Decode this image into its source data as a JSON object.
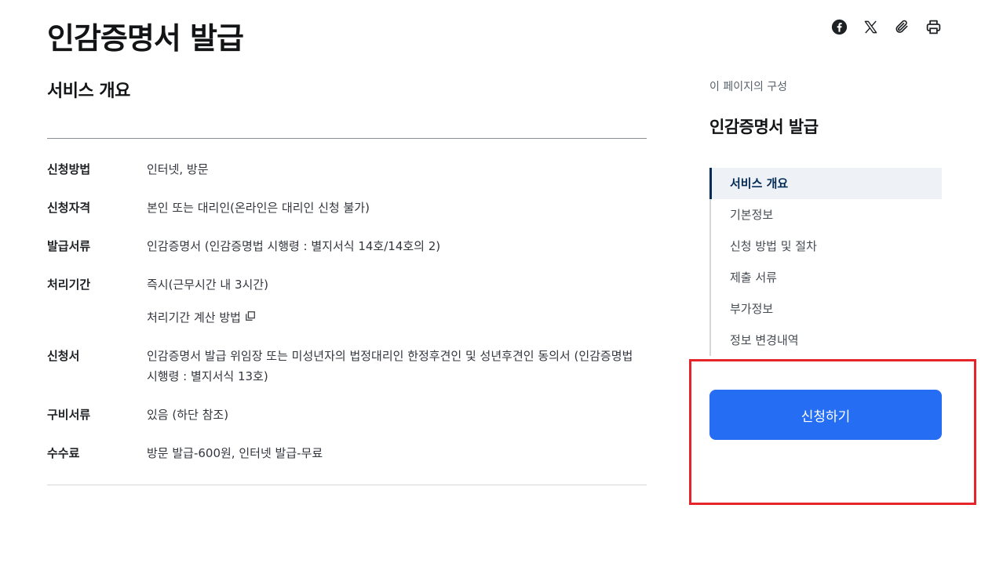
{
  "page": {
    "title": "인감증명서 발급"
  },
  "share": {
    "icons": [
      "facebook-icon",
      "x-icon",
      "paperclip-icon",
      "printer-icon"
    ]
  },
  "overview": {
    "title": "서비스 개요",
    "rows": [
      {
        "label": "신청방법",
        "value": "인터넷, 방문"
      },
      {
        "label": "신청자격",
        "value": "본인 또는 대리인(온라인은 대리인 신청 불가)"
      },
      {
        "label": "발급서류",
        "value": "인감증명서 (인감증명법 시행령 : 별지서식 14호/14호의 2)"
      },
      {
        "label": "처리기간",
        "value": "즉시(근무시간 내 3시간)",
        "link": "처리기간 계산 방법"
      },
      {
        "label": "신청서",
        "value": "인감증명서 발급 위임장 또는 미성년자의 법정대리인 한정후견인 및 성년후견인 동의서 (인감증명법 시행령 : 별지서식 13호)"
      },
      {
        "label": "구비서류",
        "value": "있음 (하단 참조)"
      },
      {
        "label": "수수료",
        "value": "방문 발급-600원, 인터넷 발급-무료"
      }
    ]
  },
  "toc": {
    "caption": "이 페이지의 구성",
    "title": "인감증명서 발급",
    "items": [
      {
        "label": "서비스 개요",
        "active": true
      },
      {
        "label": "기본정보",
        "active": false
      },
      {
        "label": "신청 방법 및 절차",
        "active": false
      },
      {
        "label": "제출 서류",
        "active": false
      },
      {
        "label": "부가정보",
        "active": false
      },
      {
        "label": "정보 변경내역",
        "active": false
      }
    ]
  },
  "apply": {
    "label": "신청하기"
  },
  "colors": {
    "primary": "#256ef4",
    "highlight": "#e5252a",
    "active_nav": "#052b57"
  }
}
